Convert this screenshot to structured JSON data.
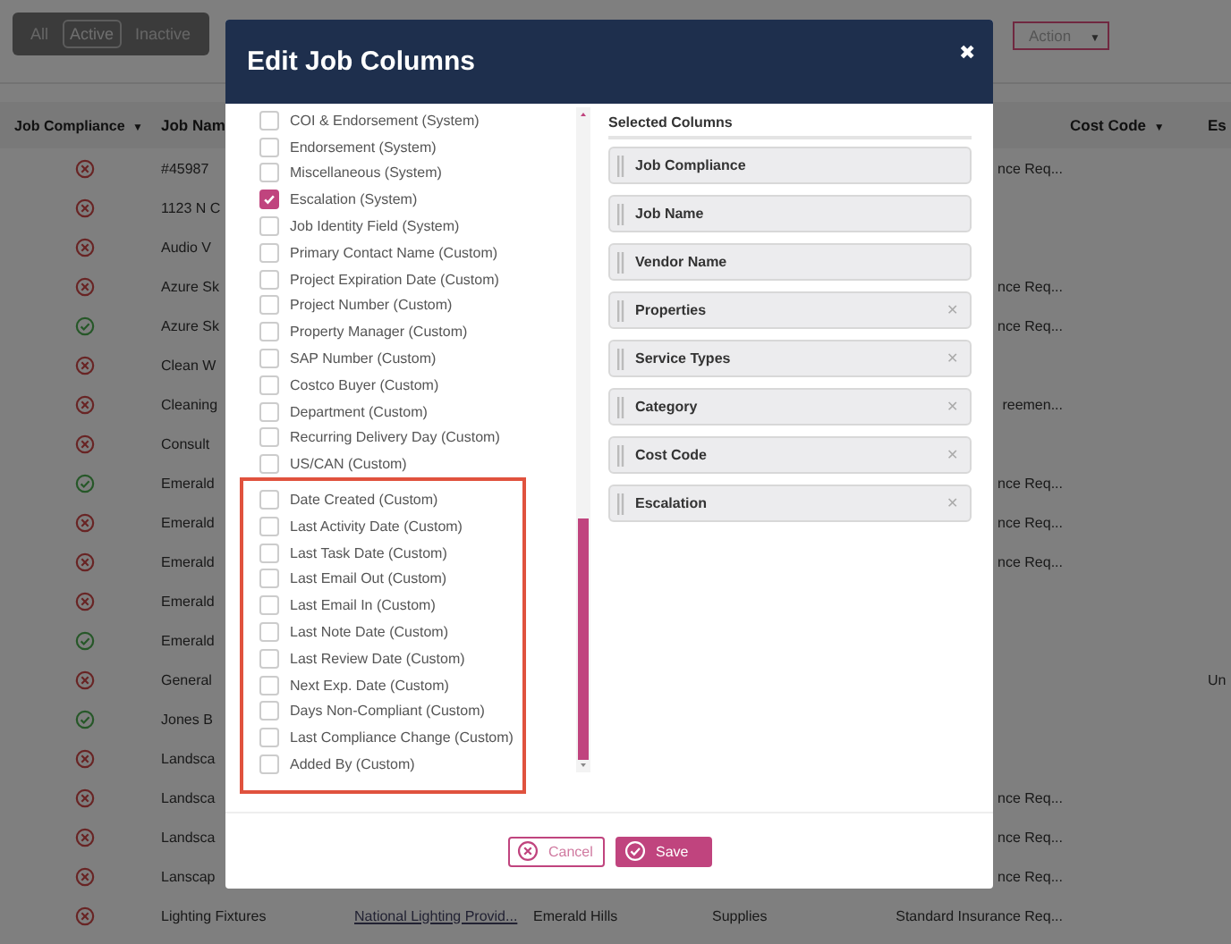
{
  "background": {
    "filter_tabs": [
      {
        "label": "All",
        "selected": false
      },
      {
        "label": "Active",
        "selected": true
      },
      {
        "label": "Inactive",
        "selected": false
      }
    ],
    "action_button": {
      "label": "Action",
      "caret": "▼"
    },
    "table": {
      "columns": [
        {
          "label": "Job Compliance",
          "caret": "▼"
        },
        {
          "label": "Job Nam"
        },
        {
          "label": "Cost Code",
          "caret": "▼"
        },
        {
          "label": "Es"
        }
      ],
      "rows": [
        {
          "compliant": false,
          "job_name": "#45987",
          "requirement": "nce Req..."
        },
        {
          "compliant": false,
          "job_name": "1123 N C"
        },
        {
          "compliant": false,
          "job_name": "Audio V"
        },
        {
          "compliant": false,
          "job_name": "Azure Sk",
          "requirement": "nce Req..."
        },
        {
          "compliant": true,
          "job_name": "Azure Sk",
          "requirement": "nce Req..."
        },
        {
          "compliant": false,
          "job_name": "Clean W"
        },
        {
          "compliant": false,
          "job_name": "Cleaning",
          "requirement": "reemen..."
        },
        {
          "compliant": false,
          "job_name": "Consult"
        },
        {
          "compliant": true,
          "job_name": "Emerald",
          "requirement": "nce Req..."
        },
        {
          "compliant": false,
          "job_name": "Emerald",
          "requirement": "nce Req..."
        },
        {
          "compliant": false,
          "job_name": "Emerald",
          "requirement": "nce Req..."
        },
        {
          "compliant": false,
          "job_name": "Emerald"
        },
        {
          "compliant": true,
          "job_name": "Emerald"
        },
        {
          "compliant": false,
          "job_name": "General",
          "escalation": "Un"
        },
        {
          "compliant": true,
          "job_name": "Jones B"
        },
        {
          "compliant": false,
          "job_name": "Landsca"
        },
        {
          "compliant": false,
          "job_name": "Landsca",
          "requirement": "nce Req..."
        },
        {
          "compliant": false,
          "job_name": "Landsca",
          "requirement": "nce Req..."
        },
        {
          "compliant": false,
          "job_name": "Lanscap",
          "requirement": "nce Req..."
        },
        {
          "compliant": false,
          "job_name": "Lighting Fixtures",
          "vendor": "National Lighting Provid...",
          "property": "Emerald Hills",
          "service_type": "Supplies",
          "requirement": "Standard Insurance Req..."
        }
      ]
    }
  },
  "dialog": {
    "title": "Edit Job Columns",
    "close": "✖",
    "available_columns": [
      {
        "label": "COI & Endorsement (System)",
        "checked": false
      },
      {
        "label": "Endorsement (System)",
        "checked": false
      },
      {
        "label": "Miscellaneous (System)",
        "checked": false
      },
      {
        "label": "Escalation (System)",
        "checked": true
      },
      {
        "label": "Job Identity Field (System)",
        "checked": false
      },
      {
        "label": "Primary Contact Name (Custom)",
        "checked": false
      },
      {
        "label": "Project Expiration Date (Custom)",
        "checked": false
      },
      {
        "label": "Project Number (Custom)",
        "checked": false
      },
      {
        "label": "Property Manager (Custom)",
        "checked": false
      },
      {
        "label": "SAP Number (Custom)",
        "checked": false
      },
      {
        "label": "Costco Buyer (Custom)",
        "checked": false
      },
      {
        "label": "Department (Custom)",
        "checked": false
      },
      {
        "label": "Recurring Delivery Day (Custom)",
        "checked": false
      },
      {
        "label": "US/CAN (Custom)",
        "checked": false
      }
    ],
    "highlighted_columns": [
      {
        "label": "Date Created (Custom)",
        "checked": false
      },
      {
        "label": "Last Activity Date (Custom)",
        "checked": false
      },
      {
        "label": "Last Task Date (Custom)",
        "checked": false
      },
      {
        "label": "Last Email Out (Custom)",
        "checked": false
      },
      {
        "label": "Last Email In (Custom)",
        "checked": false
      },
      {
        "label": "Last Note Date (Custom)",
        "checked": false
      },
      {
        "label": "Last Review Date (Custom)",
        "checked": false
      },
      {
        "label": "Next Exp. Date (Custom)",
        "checked": false
      },
      {
        "label": "Days Non-Compliant (Custom)",
        "checked": false
      },
      {
        "label": "Last Compliance Change (Custom)",
        "checked": false
      },
      {
        "label": "Added By (Custom)",
        "checked": false
      }
    ],
    "selected_heading": "Selected Columns",
    "selected_columns": [
      {
        "label": "Job Compliance",
        "removable": false
      },
      {
        "label": "Job Name",
        "removable": false
      },
      {
        "label": "Vendor Name",
        "removable": false
      },
      {
        "label": "Properties",
        "removable": true
      },
      {
        "label": "Service Types",
        "removable": true
      },
      {
        "label": "Category",
        "removable": true
      },
      {
        "label": "Cost Code",
        "removable": true
      },
      {
        "label": "Escalation",
        "removable": true
      }
    ],
    "remove_mark": "✕",
    "cancel_button": "Cancel",
    "save_button": "Save"
  }
}
